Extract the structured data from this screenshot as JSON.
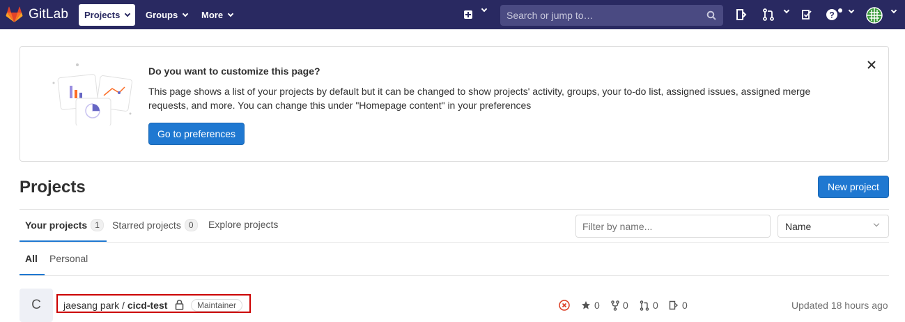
{
  "app": {
    "name": "GitLab"
  },
  "nav": {
    "items": [
      {
        "label": "Projects",
        "active": true
      },
      {
        "label": "Groups",
        "active": false
      },
      {
        "label": "More",
        "active": false
      }
    ],
    "search_placeholder": "Search or jump to…"
  },
  "banner": {
    "title": "Do you want to customize this page?",
    "body": "This page shows a list of your projects by default but it can be changed to show projects' activity, groups, your to-do list, assigned issues, assigned merge requests, and more. You can change this under \"Homepage content\" in your preferences",
    "button": "Go to preferences"
  },
  "page": {
    "title": "Projects",
    "new_project_button": "New project"
  },
  "tabs": [
    {
      "label": "Your projects",
      "count": "1",
      "active": true
    },
    {
      "label": "Starred projects",
      "count": "0",
      "active": false
    },
    {
      "label": "Explore projects",
      "count": "",
      "active": false
    }
  ],
  "filter": {
    "placeholder": "Filter by name...",
    "sort_value": "Name"
  },
  "subtabs": [
    {
      "label": "All",
      "active": true
    },
    {
      "label": "Personal",
      "active": false
    }
  ],
  "project": {
    "avatar_letter": "C",
    "namespace": "jaesang park / ",
    "name": "cicd-test",
    "role": "Maintainer",
    "stars": "0",
    "forks": "0",
    "merge_requests": "0",
    "issues": "0",
    "updated": "Updated 18 hours ago"
  },
  "colors": {
    "navbar": "#292961",
    "primary": "#1f78d1",
    "highlight_box": "#cc0000",
    "pipeline_failed": "#db3b21"
  }
}
